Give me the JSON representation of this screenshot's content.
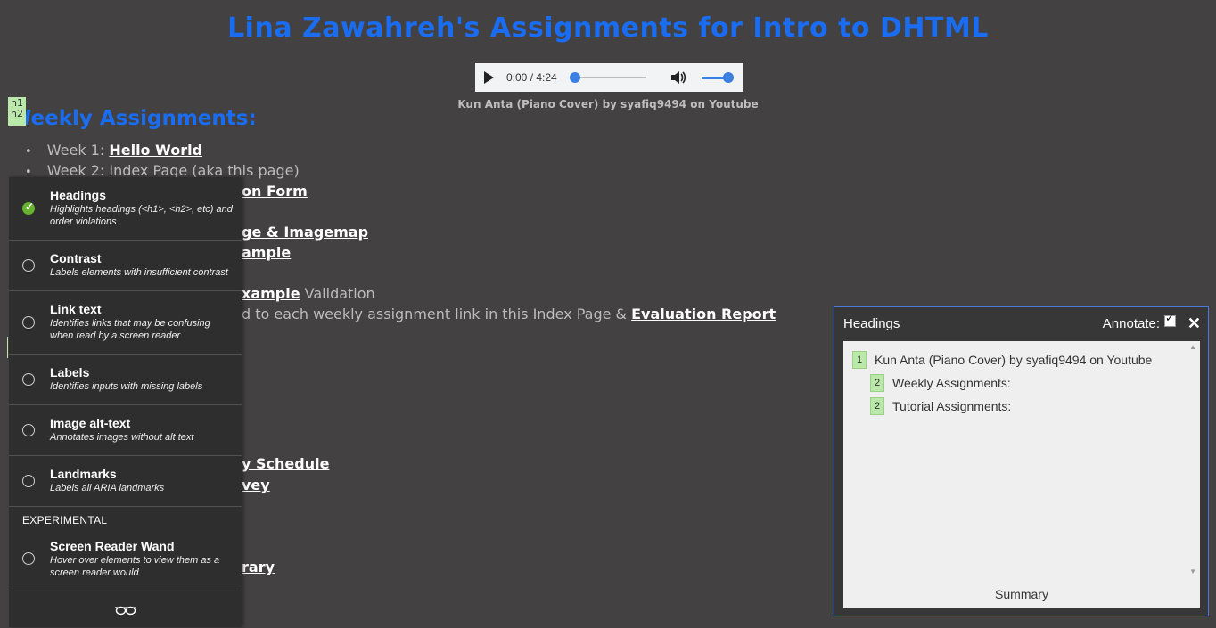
{
  "page": {
    "title": "Lina Zawahreh's Assignments for Intro to DHTML",
    "audio": {
      "time": "0:00 / 4:24"
    },
    "audio_caption": "Kun Anta (Piano Cover) by syafiq9494 on Youtube",
    "badge_h1": "h1",
    "badge_h2": "h2",
    "weekly_heading": "Weekly Assignments:",
    "weeks": [
      {
        "prefix": "Week 1: ",
        "link": "Hello World"
      },
      {
        "prefix": "Week 2: Index Page (aka this page)",
        "link": ""
      }
    ],
    "fragments": {
      "f1": "on Form",
      "f2": "ge & Imagemap",
      "f3": "ample",
      "f4_link": "xample",
      "f4_text": " Validation",
      "f5_text": "d to each weekly assignment link in this Index Page & ",
      "f5_link": "Evaluation Report",
      "f6": "y Schedule",
      "f7": "vey",
      "f8": "rary"
    }
  },
  "tools_panel": {
    "plugins": [
      {
        "name": "Headings",
        "desc": "Highlights headings (<h1>, <h2>, etc) and order violations",
        "checked": true
      },
      {
        "name": "Contrast",
        "desc": "Labels elements with insufficient contrast",
        "checked": false
      },
      {
        "name": "Link text",
        "desc": "Identifies links that may be confusing when read by a screen reader",
        "checked": false
      },
      {
        "name": "Labels",
        "desc": "Identifies inputs with missing labels",
        "checked": false
      },
      {
        "name": "Image alt-text",
        "desc": "Annotates images without alt text",
        "checked": false
      },
      {
        "name": "Landmarks",
        "desc": "Labels all ARIA landmarks",
        "checked": false
      }
    ],
    "experimental_label": "EXPERIMENTAL",
    "wand": {
      "name": "Screen Reader Wand",
      "desc": "Hover over elements to view them as a screen reader would"
    }
  },
  "headings_panel": {
    "title": "Headings",
    "annotate_label": "Annotate:",
    "close": "✕",
    "items": [
      {
        "level": "1",
        "text": "Kun Anta (Piano Cover) by syafiq9494 on Youtube"
      },
      {
        "level": "2",
        "text": "Weekly Assignments:"
      },
      {
        "level": "2",
        "text": "Tutorial Assignments:"
      }
    ],
    "summary": "Summary"
  },
  "colors": {
    "accent_blue": "#1a6cf0",
    "heading_badge": "#b9e8a9",
    "check_green": "#67b22f"
  }
}
